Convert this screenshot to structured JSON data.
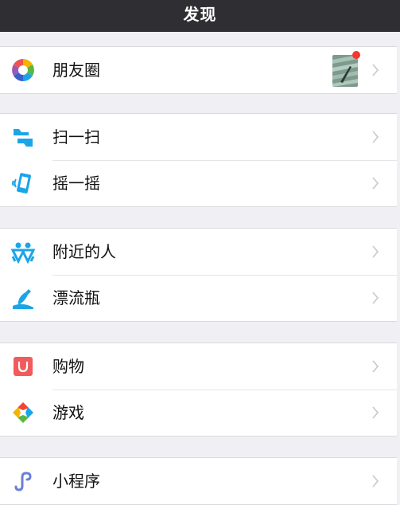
{
  "header": {
    "title": "发现"
  },
  "sections": [
    {
      "items": [
        {
          "label": "朋友圈",
          "icon": "moments-icon",
          "has_thumbnail": true,
          "has_red_dot": true
        }
      ]
    },
    {
      "items": [
        {
          "label": "扫一扫",
          "icon": "scan-icon"
        },
        {
          "label": "摇一摇",
          "icon": "shake-icon"
        }
      ]
    },
    {
      "items": [
        {
          "label": "附近的人",
          "icon": "people-nearby-icon"
        },
        {
          "label": "漂流瓶",
          "icon": "drift-bottle-icon"
        }
      ]
    },
    {
      "items": [
        {
          "label": "购物",
          "icon": "shopping-icon"
        },
        {
          "label": "游戏",
          "icon": "games-icon"
        }
      ]
    },
    {
      "items": [
        {
          "label": "小程序",
          "icon": "mini-programs-icon"
        }
      ]
    }
  ],
  "colors": {
    "header_bg": "#2f2f33",
    "page_bg": "#efeff4",
    "accent_blue": "#1aa5e8",
    "shopping_red": "#f25b5b",
    "badge_red": "#f43530",
    "chevron": "#c7c7cc"
  }
}
